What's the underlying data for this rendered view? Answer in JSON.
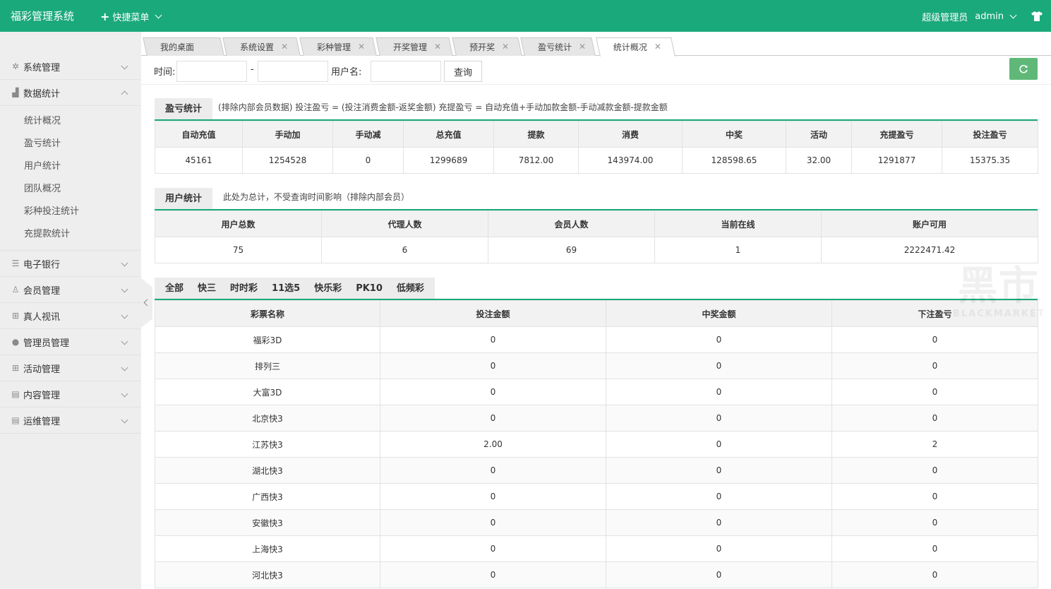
{
  "header": {
    "title": "福彩管理系统",
    "quick_menu": "快捷菜单",
    "role": "超级管理员",
    "username": "admin"
  },
  "sidebar": {
    "menus": [
      {
        "label": "系统管理",
        "icon": "gear-icon"
      },
      {
        "label": "数据统计",
        "icon": "bar-chart-icon",
        "open": true,
        "children": [
          "统计概况",
          "盈亏统计",
          "用户统计",
          "团队概况",
          "彩种投注统计",
          "充提款统计"
        ]
      },
      {
        "label": "电子银行",
        "icon": "list-icon"
      },
      {
        "label": "会员管理",
        "icon": "user-outline-icon"
      },
      {
        "label": "真人视讯",
        "icon": "gift-icon"
      },
      {
        "label": "管理员管理",
        "icon": "user-icon"
      },
      {
        "label": "活动管理",
        "icon": "gift-icon"
      },
      {
        "label": "内容管理",
        "icon": "document-icon"
      },
      {
        "label": "运维管理",
        "icon": "document-icon"
      }
    ]
  },
  "tabs": [
    {
      "label": "我的桌面",
      "closable": false
    },
    {
      "label": "系统设置",
      "closable": true
    },
    {
      "label": "彩种管理",
      "closable": true
    },
    {
      "label": "开奖管理",
      "closable": true
    },
    {
      "label": "预开奖",
      "closable": true
    },
    {
      "label": "盈亏统计",
      "closable": true
    },
    {
      "label": "统计概况",
      "closable": true,
      "active": true
    }
  ],
  "filter": {
    "time_label": "时间:",
    "separator": "-",
    "username_label": "用户名:",
    "query_button": "查询"
  },
  "profit_section": {
    "title": "盈亏统计",
    "note": "(排除内部会员数据)  投注盈亏 = (投注消费金额-返奖金额)     充提盈亏 = 自动充值+手动加款金额-手动减款金额-提款金额",
    "headers": [
      "自动充值",
      "手动加",
      "手动减",
      "总充值",
      "提款",
      "消费",
      "中奖",
      "活动",
      "充提盈亏",
      "投注盈亏"
    ],
    "values": [
      "45161",
      "1254528",
      "0",
      "1299689",
      "7812.00",
      "143974.00",
      "128598.65",
      "32.00",
      "1291877",
      "15375.35"
    ]
  },
  "user_section": {
    "title": "用户统计",
    "note": "此处为总计，不受查询时间影响（排除内部会员）",
    "headers": [
      "用户总数",
      "代理人数",
      "会员人数",
      "当前在线",
      "账户可用"
    ],
    "values": [
      "75",
      "6",
      "69",
      "1",
      "2222471.42"
    ]
  },
  "lottery_section": {
    "categories": [
      "全部",
      "快三",
      "时时彩",
      "11选5",
      "快乐彩",
      "PK10",
      "低频彩"
    ],
    "headers": [
      "彩票名称",
      "投注金额",
      "中奖金额",
      "下注盈亏"
    ],
    "rows": [
      [
        "福彩3D",
        "0",
        "0",
        "0"
      ],
      [
        "排列三",
        "0",
        "0",
        "0"
      ],
      [
        "大富3D",
        "0",
        "0",
        "0"
      ],
      [
        "北京快3",
        "0",
        "0",
        "0"
      ],
      [
        "江苏快3",
        "2.00",
        "0",
        "2"
      ],
      [
        "湖北快3",
        "0",
        "0",
        "0"
      ],
      [
        "广西快3",
        "0",
        "0",
        "0"
      ],
      [
        "安徽快3",
        "0",
        "0",
        "0"
      ],
      [
        "上海快3",
        "0",
        "0",
        "0"
      ],
      [
        "河北快3",
        "0",
        "0",
        "0"
      ]
    ]
  },
  "watermark": {
    "big": "黑市",
    "small": "BLACKMARKET"
  },
  "colors": {
    "primary": "#1aa97b",
    "refresh": "#5fb878"
  }
}
